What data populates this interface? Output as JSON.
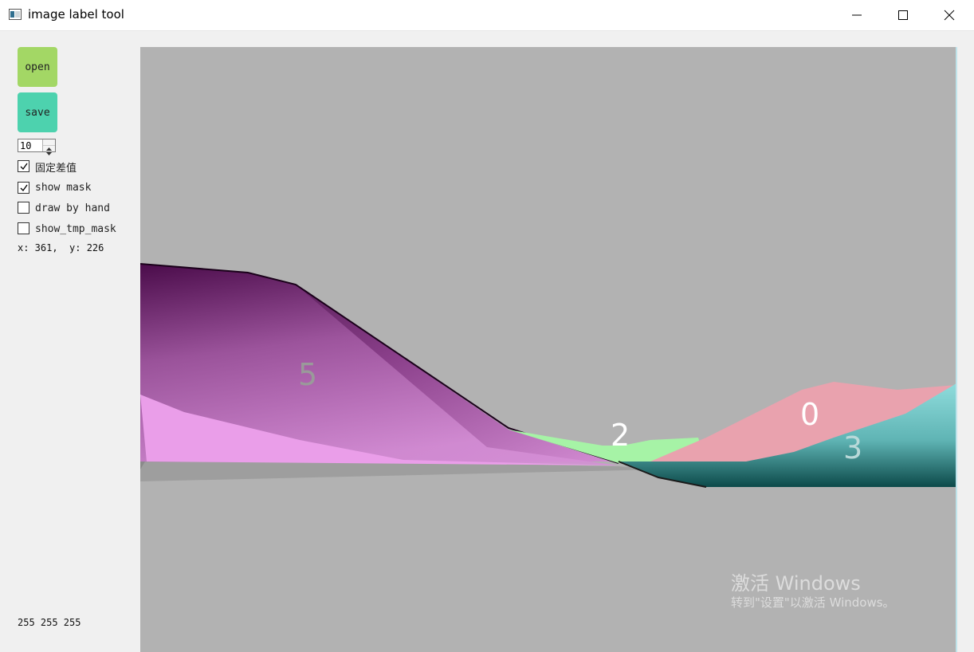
{
  "window": {
    "title": "image label tool",
    "minimize_icon": "minimize-icon",
    "maximize_icon": "maximize-icon",
    "close_icon": "close-icon"
  },
  "sidebar": {
    "open_label": "open",
    "save_label": "save",
    "open_color": "#a3d765",
    "save_color": "#4dd2ae",
    "spinner_value": "10",
    "checkboxes": [
      {
        "label": "固定差值",
        "checked": true
      },
      {
        "label": "show mask",
        "checked": true
      },
      {
        "label": "draw by hand",
        "checked": false
      },
      {
        "label": "show_tmp_mask",
        "checked": false
      }
    ],
    "coords": "x: 361,  y: 226",
    "rgb": "255 255 255"
  },
  "canvas": {
    "background": "#b2b2b2",
    "labels": [
      {
        "text": "5",
        "color": "#9a9a9a"
      },
      {
        "text": "2",
        "color": "#ffffff"
      },
      {
        "text": "0",
        "color": "#ffffff"
      },
      {
        "text": "3",
        "color": "#b9d9d9"
      }
    ]
  },
  "watermark": {
    "line1": "激活 Windows",
    "line2": "转到\"设置\"以激活 Windows。"
  }
}
